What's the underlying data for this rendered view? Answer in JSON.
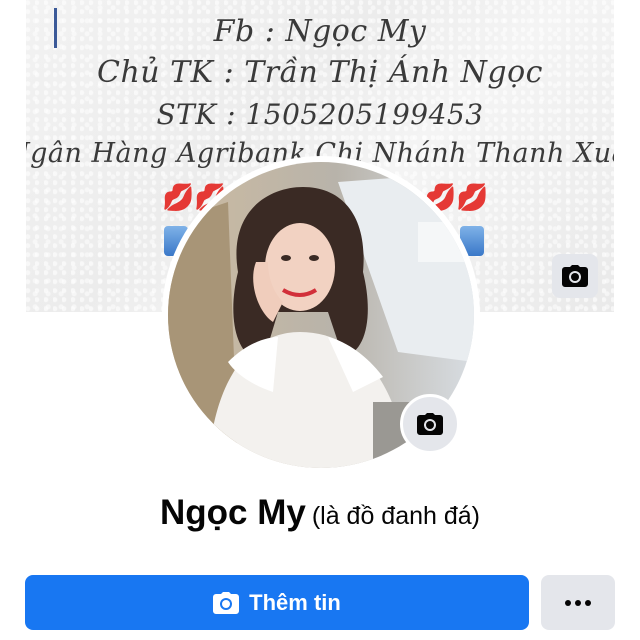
{
  "cover": {
    "line1": "Fb : Ngọc My",
    "line2": "Chủ TK : Trần Thị Ánh Ngọc",
    "line3": "STK : 1505205199453",
    "line4": "Ngân Hàng Agribank Chi Nhánh Thanh Xuân",
    "lips": "💋💋"
  },
  "profile": {
    "name": "Ngọc My",
    "alternate_name": "(là đồ đanh đá)"
  },
  "actions": {
    "add_story_label": "Thêm tin"
  },
  "icons": {
    "cover_camera": "camera-icon",
    "avatar_camera": "camera-icon",
    "add_story": "camera-icon",
    "more": "more-dots-icon"
  },
  "colors": {
    "primary": "#1877f2",
    "secondary_button": "#e4e6eb",
    "text": "#050505"
  }
}
